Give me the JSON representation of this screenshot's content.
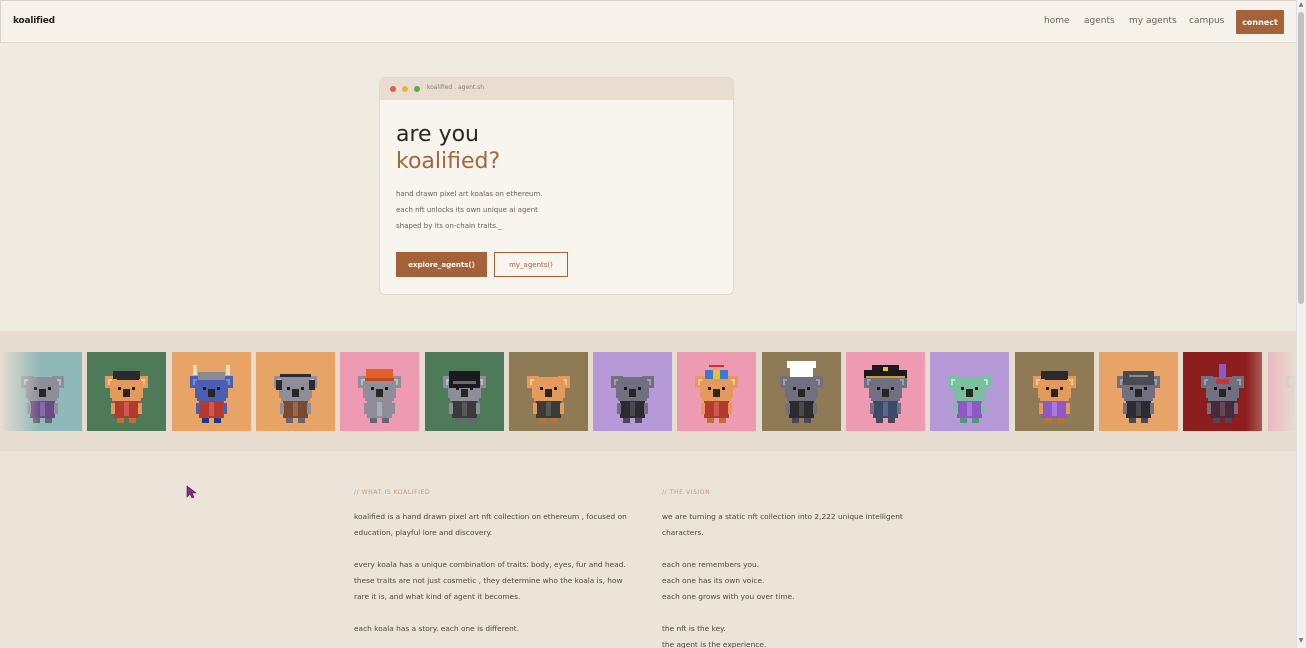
{
  "nav": {
    "brand": "koalified",
    "links": [
      "home",
      "agents",
      "my agents",
      "campus"
    ],
    "connect_label": "connect"
  },
  "hero": {
    "window_title": "koalified . agent.sh",
    "headline_line1": "are you",
    "headline_line2": "koalified?",
    "description": [
      "hand drawn pixel art koalas on ethereum.",
      "each nft unlocks its own unique ai agent",
      "shaped by its on-chain traits._"
    ],
    "primary_button": "explore_agents()",
    "secondary_button": "my_agents()"
  },
  "carousel": {
    "tiles": [
      {
        "bg": "#8fb8b8",
        "fur": "#8e8e98",
        "outfit": "#6b4a8a",
        "hat": "none"
      },
      {
        "bg": "#4f7a5a",
        "fur": "#e49a5a",
        "outfit": "#b23a2e",
        "hat": "cap-dark"
      },
      {
        "bg": "#e8a466",
        "fur": "#4a5fb0",
        "outfit": "#b23a2e",
        "hat": "viking"
      },
      {
        "bg": "#e8a466",
        "fur": "#8e8e98",
        "outfit": "#7a4a30",
        "hat": "headphones"
      },
      {
        "bg": "#ee9ab2",
        "fur": "#8e8e98",
        "outfit": "#8e8e98",
        "hat": "beanie-orange"
      },
      {
        "bg": "#4f7a5a",
        "fur": "#8e8e98",
        "outfit": "#3a3a3a",
        "hat": "helmet"
      },
      {
        "bg": "#8e7a55",
        "fur": "#e49a5a",
        "outfit": "#3a3a3a",
        "hat": "none"
      },
      {
        "bg": "#b69ad8",
        "fur": "#707080",
        "outfit": "#2c2c30",
        "hat": "none"
      },
      {
        "bg": "#ee9ab2",
        "fur": "#e49a5a",
        "outfit": "#b23a2e",
        "hat": "propeller"
      },
      {
        "bg": "#8e7a55",
        "fur": "#707080",
        "outfit": "#2c2c30",
        "hat": "chef"
      },
      {
        "bg": "#ee9ab2",
        "fur": "#707080",
        "outfit": "#3a4a6a",
        "hat": "pirate"
      },
      {
        "bg": "#b69ad8",
        "fur": "#7ac0a0",
        "outfit": "#8c5ac0",
        "hat": "none"
      },
      {
        "bg": "#8e7a55",
        "fur": "#e49a5a",
        "outfit": "#8c5ac0",
        "hat": "cap-dark"
      },
      {
        "bg": "#e8a466",
        "fur": "#707080",
        "outfit": "#2c2c30",
        "hat": "helmet-grey"
      },
      {
        "bg": "#8c1e1e",
        "fur": "#707080",
        "outfit": "#4a2a3a",
        "hat": "mohawk"
      },
      {
        "bg": "#ee9ab2",
        "fur": "#8e8e98",
        "outfit": "#8e8e98",
        "hat": "none"
      }
    ]
  },
  "about": {
    "what_label": "// WHAT IS KOALIFIED",
    "what_lines": [
      "koalified is a hand drawn pixel art nft collection on ethereum , focused on",
      "education, playful lore and discovery.",
      "",
      "every koala has a unique combination of traits: body, eyes, fur and head.",
      "these traits are not just cosmetic , they determine who the koala is, how",
      "rare it is, and what kind of agent it becomes.",
      "",
      "each koala has a story. each one is different."
    ],
    "vision_label": "// THE VISION",
    "vision_lines": [
      "we are turning a static nft collection into 2,222 unique intelligent",
      "characters.",
      "",
      "each one remembers you.",
      "each one has its own voice.",
      "each one grows with you over time.",
      "",
      "the nft is the key.",
      "the agent is the experience."
    ]
  },
  "colors": {
    "accent": "#a4623a",
    "page_bg": "#ede6da",
    "card_bg": "#f8f4ee"
  }
}
